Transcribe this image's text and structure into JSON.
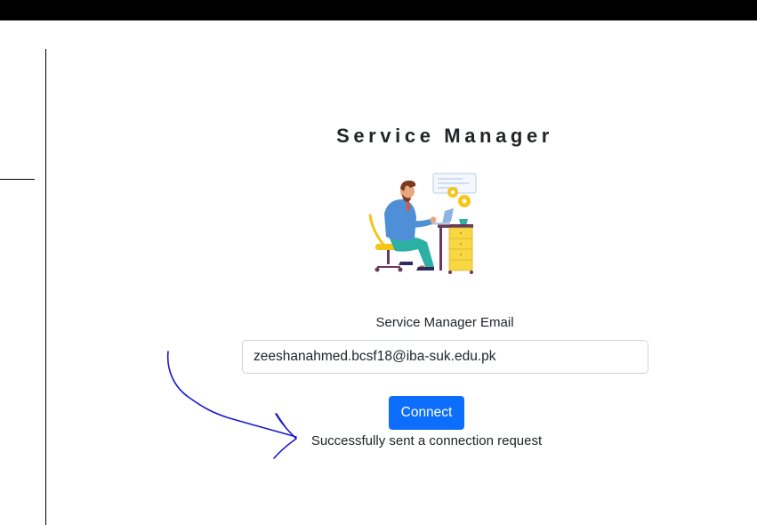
{
  "header": {
    "bar_color": "#000000"
  },
  "page": {
    "title": "Service Manager",
    "illustration_icon": "person-working-at-desk-illustration"
  },
  "form": {
    "email_label": "Service Manager Email",
    "email_value": "zeeshanahmed.bcsf18@iba-suk.edu.pk",
    "connect_label": "Connect",
    "button_color": "#0d6efd"
  },
  "status": {
    "message": "Successfully sent a connection request"
  },
  "annotation": {
    "icon": "hand-drawn-arrow-icon",
    "color": "#1a1acc"
  }
}
